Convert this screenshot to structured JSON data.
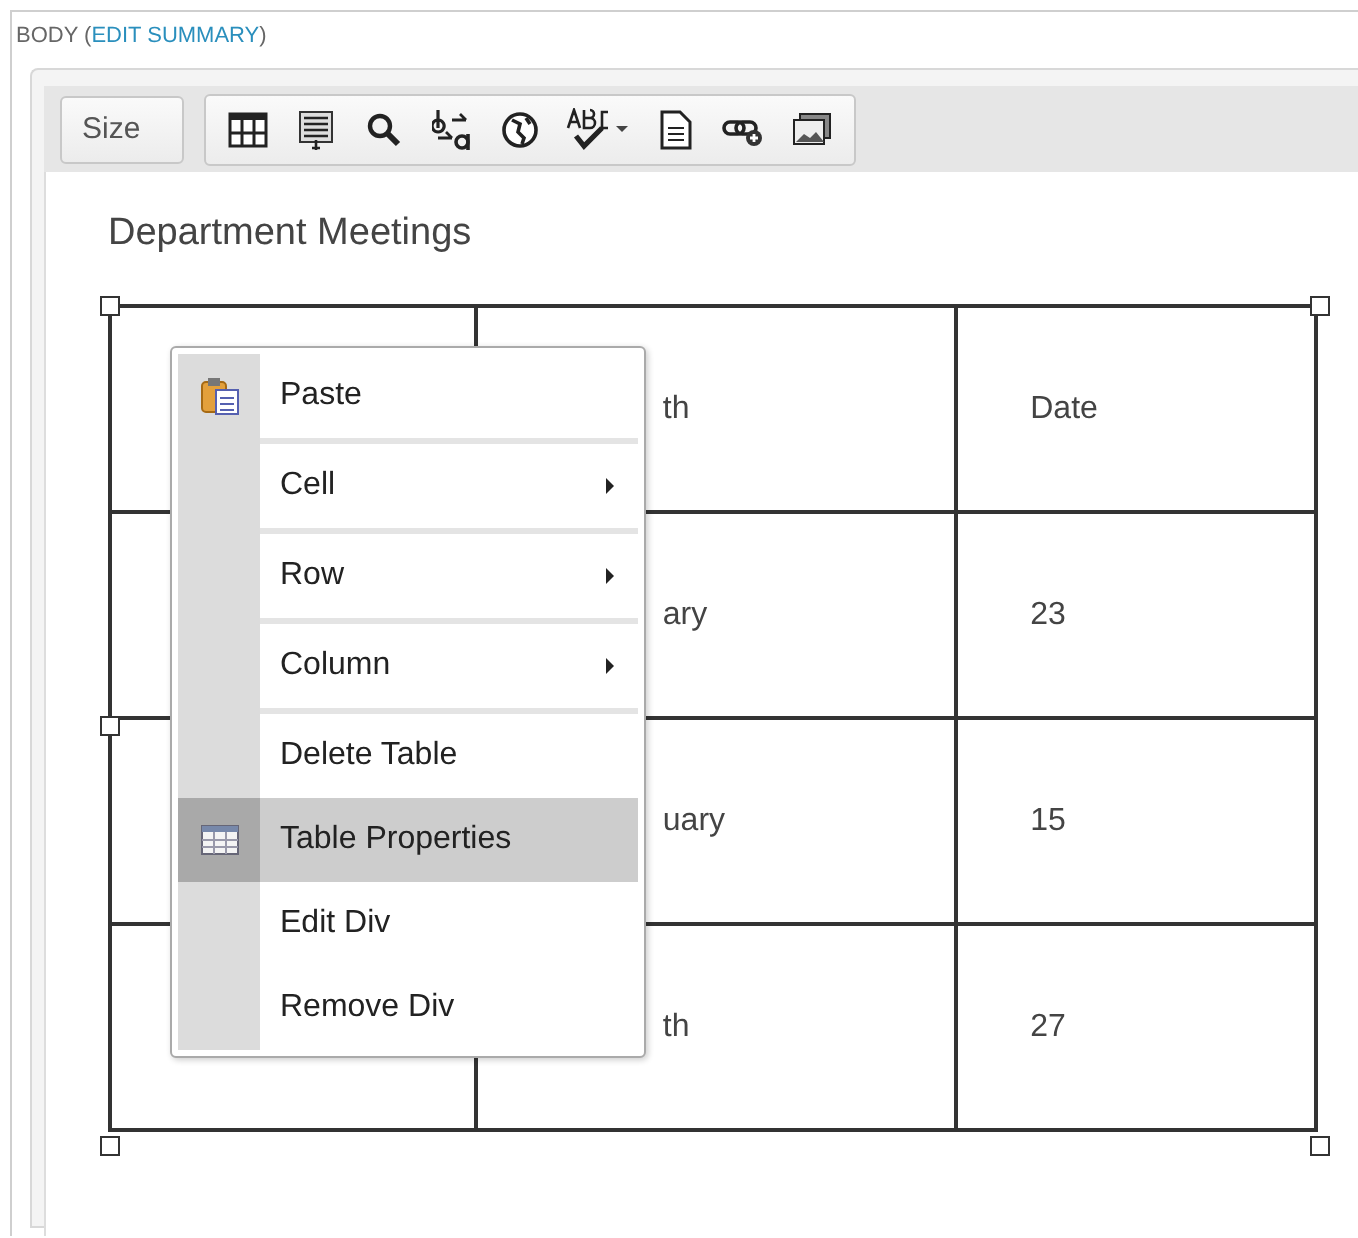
{
  "field": {
    "label": "BODY (",
    "link": "EDIT SUMMARY",
    "label_end": ")"
  },
  "toolbar": {
    "dropdown": "Size"
  },
  "content": {
    "heading": "Department Meetings",
    "table": {
      "rows": [
        [
          "",
          "th",
          "Date"
        ],
        [
          "",
          "ary",
          "23"
        ],
        [
          "",
          "uary",
          "15"
        ],
        [
          "",
          "th",
          "27"
        ]
      ]
    }
  },
  "context_menu": {
    "items": [
      {
        "label": "Paste",
        "kind": "clipboard",
        "submenu": false,
        "selected": false,
        "separator_after": true
      },
      {
        "label": "Cell",
        "kind": "plain",
        "submenu": true,
        "selected": false,
        "separator_after": true
      },
      {
        "label": "Row",
        "kind": "plain",
        "submenu": true,
        "selected": false,
        "separator_after": true
      },
      {
        "label": "Column",
        "kind": "plain",
        "submenu": true,
        "selected": false,
        "separator_after": true
      },
      {
        "label": "Delete Table",
        "kind": "plain",
        "submenu": false,
        "selected": false,
        "separator_after": false
      },
      {
        "label": "Table Properties",
        "kind": "table",
        "submenu": false,
        "selected": true,
        "separator_after": false
      },
      {
        "label": "Edit Div",
        "kind": "plain",
        "submenu": false,
        "selected": false,
        "separator_after": false
      },
      {
        "label": "Remove Div",
        "kind": "plain",
        "submenu": false,
        "selected": false,
        "separator_after": false
      }
    ]
  }
}
